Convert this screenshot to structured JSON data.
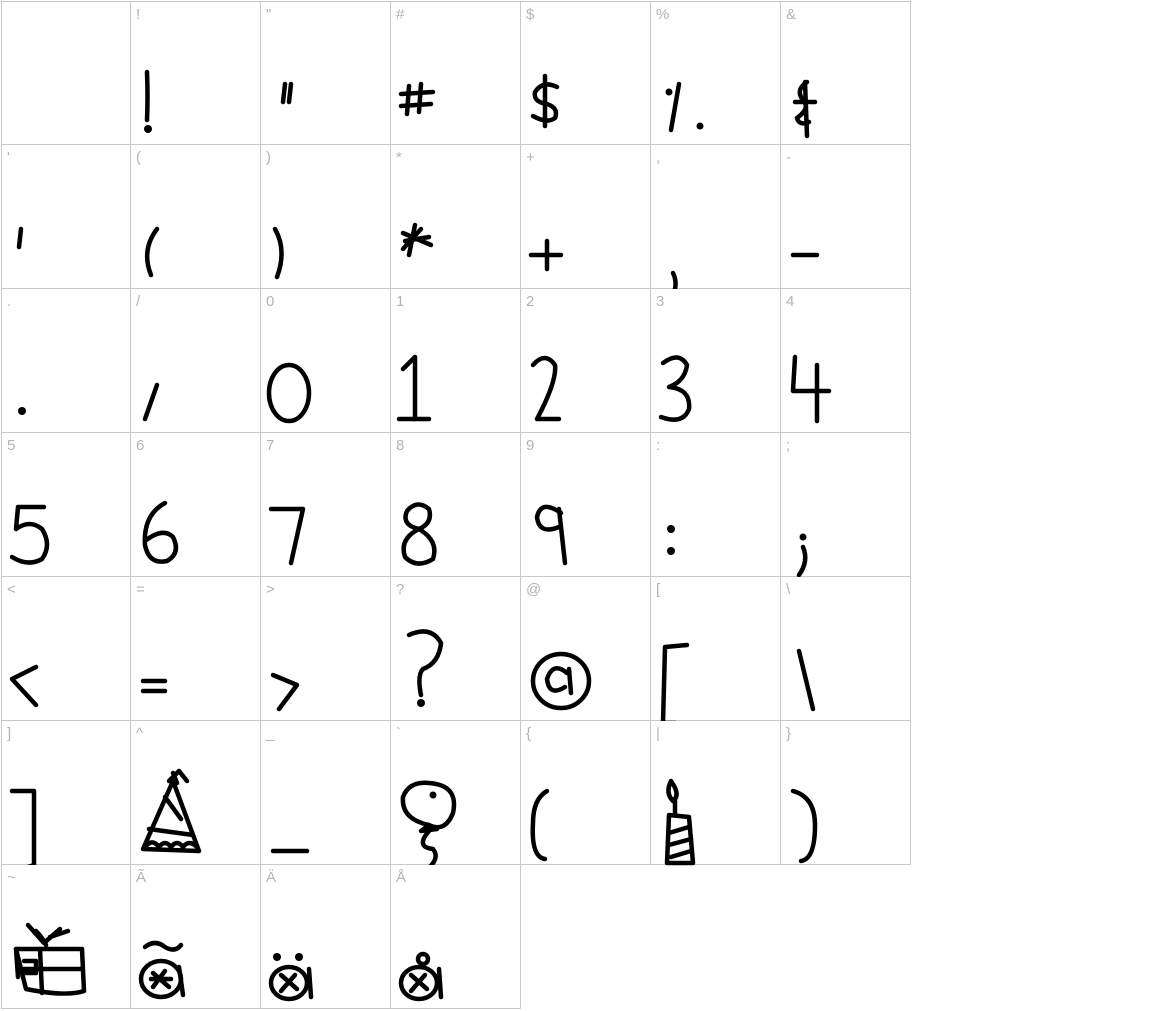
{
  "font_preview": {
    "columns": 7,
    "glyph_color": "#000000",
    "label_color": "#b3b3b3",
    "cells": [
      {
        "char": "",
        "glyph": "space"
      },
      {
        "char": "!",
        "glyph": "exclam"
      },
      {
        "char": "\"",
        "glyph": "quotedbl"
      },
      {
        "char": "#",
        "glyph": "numbersign"
      },
      {
        "char": "$",
        "glyph": "dollar"
      },
      {
        "char": "%",
        "glyph": "percent"
      },
      {
        "char": "&",
        "glyph": "ampersand"
      },
      {
        "char": "'",
        "glyph": "quotesingle"
      },
      {
        "char": "(",
        "glyph": "parenleft"
      },
      {
        "char": ")",
        "glyph": "parenright"
      },
      {
        "char": "*",
        "glyph": "asterisk"
      },
      {
        "char": "+",
        "glyph": "plus"
      },
      {
        "char": ",",
        "glyph": "comma"
      },
      {
        "char": "-",
        "glyph": "hyphen"
      },
      {
        "char": ".",
        "glyph": "period"
      },
      {
        "char": "/",
        "glyph": "slash"
      },
      {
        "char": "0",
        "glyph": "zero"
      },
      {
        "char": "1",
        "glyph": "one"
      },
      {
        "char": "2",
        "glyph": "two"
      },
      {
        "char": "3",
        "glyph": "three"
      },
      {
        "char": "4",
        "glyph": "four"
      },
      {
        "char": "5",
        "glyph": "five"
      },
      {
        "char": "6",
        "glyph": "six"
      },
      {
        "char": "7",
        "glyph": "seven"
      },
      {
        "char": "8",
        "glyph": "eight"
      },
      {
        "char": "9",
        "glyph": "nine"
      },
      {
        "char": ":",
        "glyph": "colon"
      },
      {
        "char": ";",
        "glyph": "semicolon"
      },
      {
        "char": "<",
        "glyph": "less"
      },
      {
        "char": "=",
        "glyph": "equal"
      },
      {
        "char": ">",
        "glyph": "greater"
      },
      {
        "char": "?",
        "glyph": "question"
      },
      {
        "char": "@",
        "glyph": "at"
      },
      {
        "char": "[",
        "glyph": "bracketleft"
      },
      {
        "char": "\\",
        "glyph": "backslash"
      },
      {
        "char": "]",
        "glyph": "bracketright"
      },
      {
        "char": "^",
        "glyph": "party-hat"
      },
      {
        "char": "_",
        "glyph": "underscore"
      },
      {
        "char": "`",
        "glyph": "balloon"
      },
      {
        "char": "{",
        "glyph": "braceleft"
      },
      {
        "char": "|",
        "glyph": "candle"
      },
      {
        "char": "}",
        "glyph": "braceright"
      },
      {
        "char": "~",
        "glyph": "gift"
      },
      {
        "char": "Ã",
        "glyph": "a-tilde"
      },
      {
        "char": "Ä",
        "glyph": "a-dieresis"
      },
      {
        "char": "Å",
        "glyph": "a-ring"
      }
    ]
  }
}
